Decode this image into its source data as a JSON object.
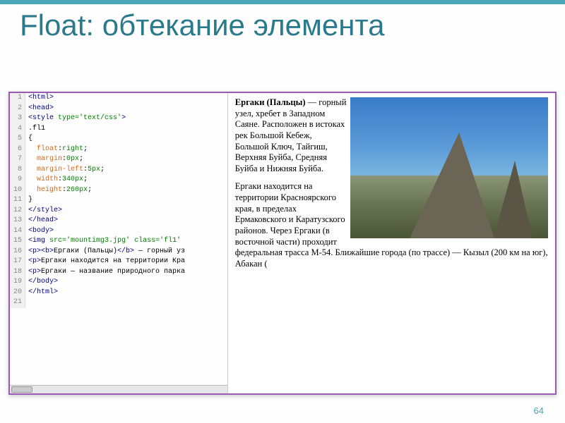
{
  "slide": {
    "title": "Float: обтекание элемента",
    "page_number": "64"
  },
  "code": {
    "lines": [
      {
        "n": "1",
        "html": "<span class='tag'>&lt;html&gt;</span>"
      },
      {
        "n": "2",
        "html": "<span class='tag'>&lt;head&gt;</span>"
      },
      {
        "n": "3",
        "html": "<span class='tag'>&lt;style</span> <span class='attr'>type=</span><span class='str'>'text/css'</span><span class='tag'>&gt;</span>"
      },
      {
        "n": "4",
        "html": ".fl1"
      },
      {
        "n": "5",
        "html": "{"
      },
      {
        "n": "6",
        "html": "  <span class='prop'>float</span>:<span class='val'>right</span>;"
      },
      {
        "n": "7",
        "html": "  <span class='prop'>margin</span>:<span class='val'>0px</span>;"
      },
      {
        "n": "8",
        "html": "  <span class='prop'>margin-left</span>:<span class='val'>5px</span>;"
      },
      {
        "n": "9",
        "html": "  <span class='prop'>width</span>:<span class='val'>340px</span>;"
      },
      {
        "n": "10",
        "html": "  <span class='prop'>height</span>:<span class='val'>260px</span>;"
      },
      {
        "n": "11",
        "html": "}"
      },
      {
        "n": "12",
        "html": "<span class='tag'>&lt;/style&gt;</span>"
      },
      {
        "n": "13",
        "html": "<span class='tag'>&lt;/head&gt;</span>"
      },
      {
        "n": "14",
        "html": "<span class='tag'>&lt;body&gt;</span>"
      },
      {
        "n": "15",
        "html": "<span class='tag'>&lt;img</span> <span class='attr'>src=</span><span class='str'>'mountimg3.jpg'</span> <span class='attr'>class=</span><span class='str'>'fl1'</span>"
      },
      {
        "n": "16",
        "html": "<span class='tag'>&lt;p&gt;&lt;b&gt;</span>Ергаки (Пальцы)<span class='tag'>&lt;/b&gt;</span> — горный уз"
      },
      {
        "n": "17",
        "html": "<span class='tag'>&lt;p&gt;</span>Ергаки находится на территории Кра"
      },
      {
        "n": "18",
        "html": "<span class='tag'>&lt;p&gt;</span>Ергаки — название природного парка"
      },
      {
        "n": "19",
        "html": "<span class='tag'>&lt;/body&gt;</span>"
      },
      {
        "n": "20",
        "html": "<span class='tag'>&lt;/html&gt;</span>"
      },
      {
        "n": "21",
        "html": ""
      }
    ]
  },
  "preview": {
    "bold": "Ергаки (Пальцы)",
    "p1_rest": " — горный узел, хребет в Западном Саяне. Расположен в истоках рек Большой Кебеж, Большой Ключ, Тайгиш, Верхняя Буйба, Средняя Буйба и Нижняя Буйба.",
    "p2": "Ергаки находится на территории Красноярского края, в пределах Ермаковского и Каратузского районов. Через Ергаки (в восточной части) проходит федеральная трасса М-54. Ближайшие города (по трассе) — Кызыл (200 км на юг), Абакан ("
  }
}
